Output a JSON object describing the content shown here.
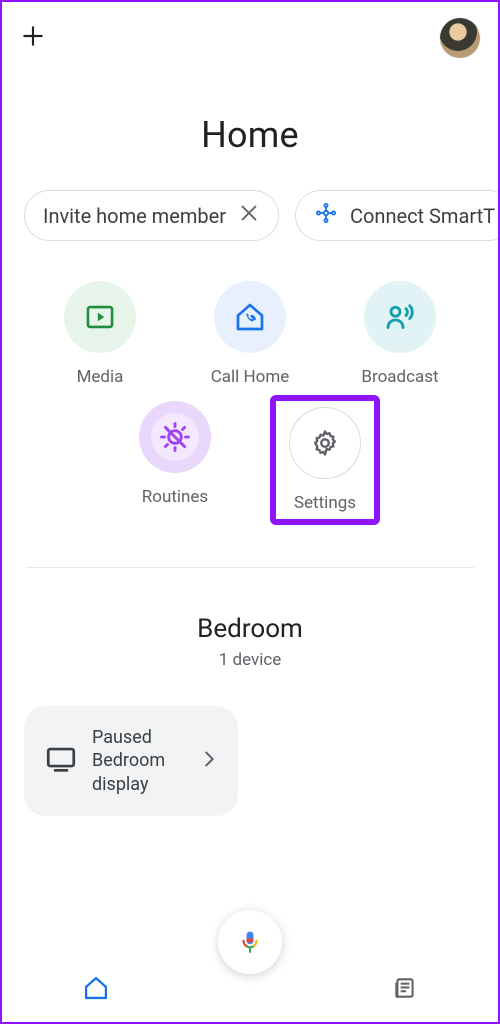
{
  "header": {
    "title": "Home"
  },
  "chips": {
    "invite": "Invite home member",
    "connect": "Connect SmartT"
  },
  "actions": {
    "media": "Media",
    "callhome": "Call Home",
    "broadcast": "Broadcast",
    "routines": "Routines",
    "settings": "Settings"
  },
  "room": {
    "name": "Bedroom",
    "subtitle": "1 device"
  },
  "device": {
    "status": "Paused",
    "name": "Bedroom display"
  }
}
